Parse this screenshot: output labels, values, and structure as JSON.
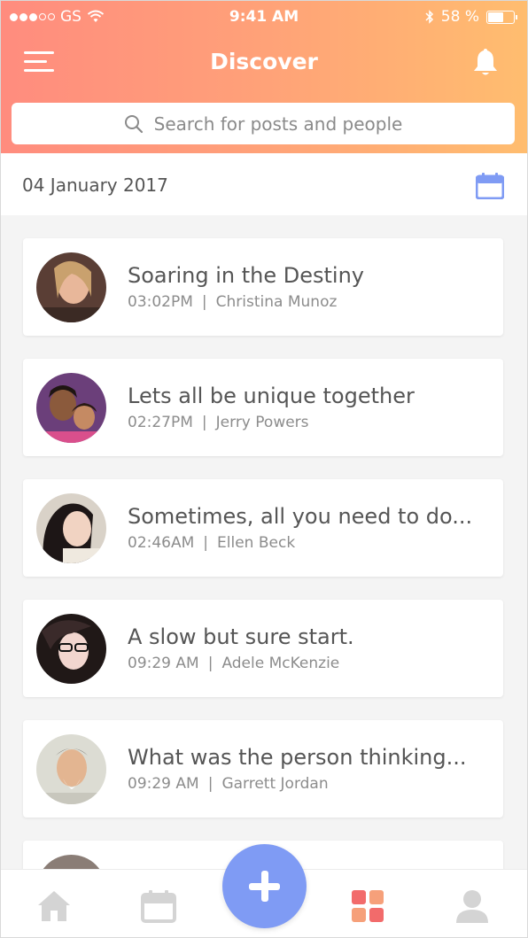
{
  "status_bar": {
    "carrier": "GS",
    "time": "9:41 AM",
    "battery": "58 %"
  },
  "header": {
    "title": "Discover",
    "menu_icon": "hamburger-menu-icon",
    "bell_icon": "bell-icon"
  },
  "search": {
    "placeholder": "Search for posts and people",
    "icon": "search-icon"
  },
  "date_row": {
    "date": "04 January 2017",
    "calendar_icon": "calendar-icon",
    "accent_color": "#7f9bf4"
  },
  "posts": [
    {
      "title": "Soaring in the Destiny",
      "time": "03:02PM",
      "author": "Christina Munoz"
    },
    {
      "title": "Lets all be unique together",
      "time": "02:27PM",
      "author": "Jerry Powers"
    },
    {
      "title": "Sometimes, all you need to do...",
      "time": "02:46AM",
      "author": "Ellen Beck"
    },
    {
      "title": "A slow but sure start.",
      "time": "09:29 AM",
      "author": "Adele McKenzie"
    },
    {
      "title": "What was the person thinking...",
      "time": "09:29 AM",
      "author": "Garrett Jordan"
    }
  ],
  "tabbar": {
    "items": [
      "home-icon",
      "calendar-icon",
      "add-icon",
      "grid-icon",
      "profile-icon"
    ],
    "active_color": "#f26b6b",
    "inactive_color": "#d4d4d4",
    "fab_color": "#7f9bf4"
  },
  "colors": {
    "header_start": "#ff8c7e",
    "header_end": "#ffbd6f"
  }
}
